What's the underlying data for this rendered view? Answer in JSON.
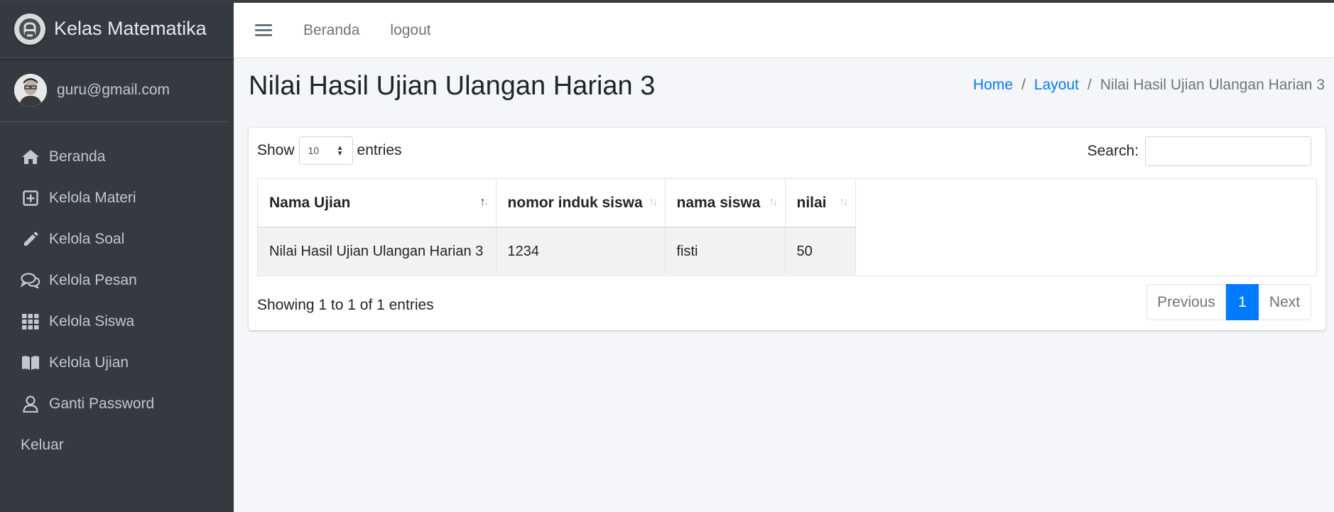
{
  "brand": {
    "title": "Kelas Matematika"
  },
  "user": {
    "email": "guru@gmail.com"
  },
  "sidebar": {
    "items": [
      {
        "label": "Beranda",
        "icon": "home-icon"
      },
      {
        "label": "Kelola Materi",
        "icon": "plus-square-icon"
      },
      {
        "label": "Kelola Soal",
        "icon": "pencil-icon"
      },
      {
        "label": "Kelola Pesan",
        "icon": "comments-icon"
      },
      {
        "label": "Kelola Siswa",
        "icon": "grid-icon"
      },
      {
        "label": "Kelola Ujian",
        "icon": "book-icon"
      },
      {
        "label": "Ganti Password",
        "icon": "user-icon"
      },
      {
        "label": "Keluar"
      }
    ]
  },
  "topbar": {
    "links": [
      "Beranda",
      "logout"
    ]
  },
  "page": {
    "title": "Nilai Hasil Ujian Ulangan Harian 3"
  },
  "breadcrumb": {
    "home": "Home",
    "layout": "Layout",
    "current": "Nilai Hasil Ujian Ulangan Harian 3"
  },
  "table_controls": {
    "show_label": "Show",
    "entries_value": "10",
    "entries_label": "entries",
    "search_label": "Search:",
    "search_value": ""
  },
  "table": {
    "headers": [
      "Nama Ujian",
      "nomor induk siswa",
      "nama siswa",
      "nilai"
    ],
    "rows": [
      [
        "Nilai Hasil Ujian Ulangan Harian 3",
        "1234",
        "fisti",
        "50"
      ]
    ]
  },
  "footer": {
    "info": "Showing 1 to 1 of 1 entries",
    "prev": "Previous",
    "page": "1",
    "next": "Next"
  },
  "colors": {
    "sidebar": "#343a40",
    "accent": "#007bff",
    "content_bg": "#f4f6f9"
  }
}
